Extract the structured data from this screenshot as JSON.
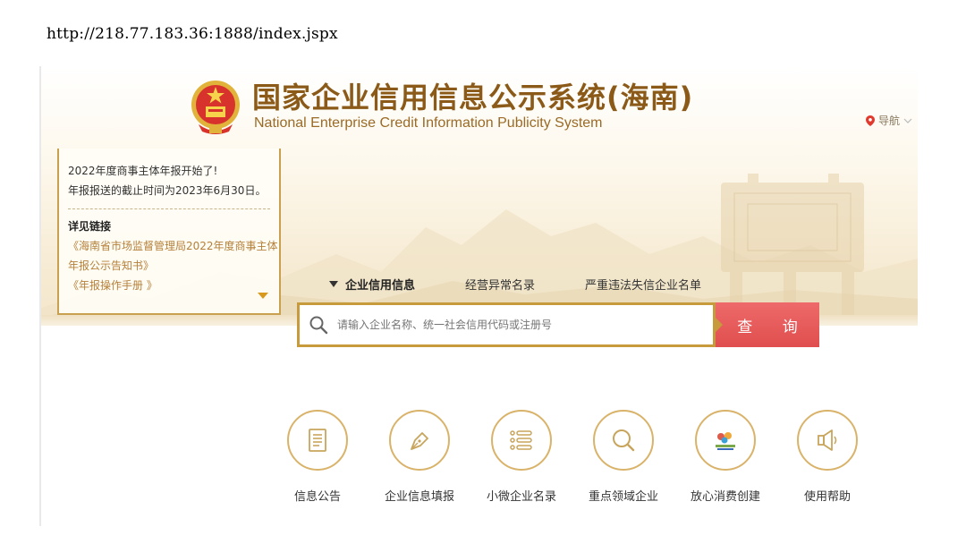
{
  "browser": {
    "url": "http://218.77.183.36:1888/index.jspx"
  },
  "header": {
    "title_cn": "国家企业信用信息公示系统(海南)",
    "title_en": "National Enterprise Credit Information Publicity System",
    "nav_label": "导航"
  },
  "notice": {
    "line1": "2022年度商事主体年报开始了!",
    "line2": "年报报送的截止时间为2023年6月30日。",
    "details_heading": "详见链接",
    "link1_line1": "《海南省市场监督管理局2022年度商事主体",
    "link1_line2": "年报公示告知书》",
    "link2": "《年报操作手册 》"
  },
  "search": {
    "tabs": [
      {
        "label": "企业信用信息",
        "active": true
      },
      {
        "label": "经营异常名录",
        "active": false
      },
      {
        "label": "严重违法失信企业名单",
        "active": false
      }
    ],
    "placeholder": "请输入企业名称、统一社会信用代码或注册号",
    "button_label": "查 询"
  },
  "quick_links": [
    {
      "label": "信息公告",
      "icon": "document-icon"
    },
    {
      "label": "企业信息填报",
      "icon": "pen-icon"
    },
    {
      "label": "小微企业名录",
      "icon": "list-icon"
    },
    {
      "label": "重点领域企业",
      "icon": "magnifier-icon"
    },
    {
      "label": "放心消费创建",
      "icon": "consumer-logo-icon"
    },
    {
      "label": "使用帮助",
      "icon": "speaker-icon"
    }
  ],
  "colors": {
    "brand_brown": "#8b5a18",
    "gold": "#c79a3c",
    "search_red": "#e04e4e",
    "link_orange": "#b5803a"
  }
}
